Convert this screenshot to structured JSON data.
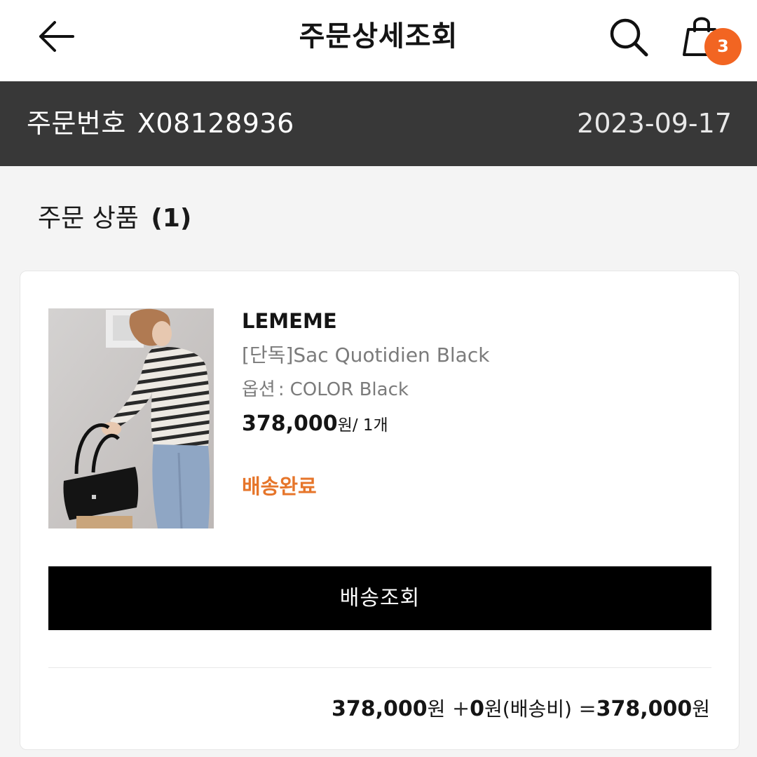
{
  "header": {
    "title": "주문상세조회",
    "cart_count": "3"
  },
  "order": {
    "number_label": "주문번호",
    "number": "X08128936",
    "date": "2023-09-17"
  },
  "section": {
    "title": "주문 상품",
    "count": "(1)"
  },
  "item": {
    "brand": "LEMEME",
    "name": "[단독]Sac Quotidien Black",
    "option_label": "옵션",
    "option_sep": ":",
    "option_value": "COLOR Black",
    "price": "378,000",
    "price_unit": "원",
    "quantity": "/ 1개",
    "status": "배송완료"
  },
  "actions": {
    "track_label": "배송조회"
  },
  "summary": {
    "product_amount": "378,000",
    "product_unit": "원",
    "shipping_prefix": "+",
    "shipping_amount": "0",
    "shipping_unit": "원",
    "shipping_label": "(배송비)",
    "equals": "=",
    "total_amount": "378,000",
    "total_unit": "원"
  },
  "colors": {
    "accent": "#f26522",
    "status": "#e6752a",
    "order_bar": "#383838"
  },
  "icons": [
    "arrow-left-icon",
    "search-icon",
    "shopping-bag-icon"
  ]
}
